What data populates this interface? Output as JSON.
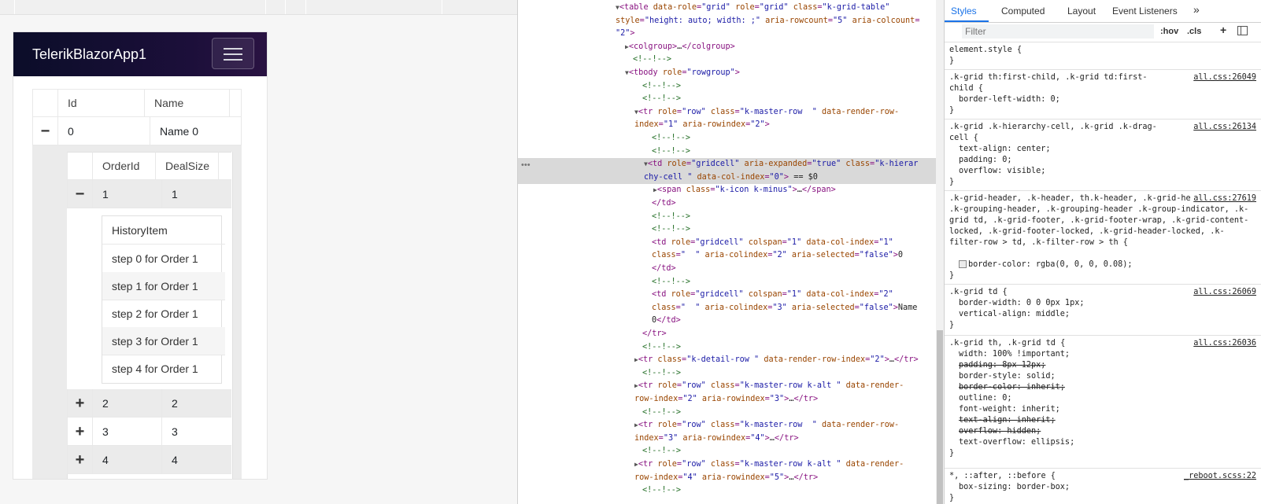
{
  "app": {
    "brand": "TelerikBlazorApp1",
    "grid": {
      "headers": [
        "Id",
        "Name"
      ],
      "row": {
        "icon": "−",
        "id": "0",
        "name": "Name 0"
      },
      "detail": {
        "headers": [
          "OrderId",
          "DealSize"
        ],
        "expanded_row": {
          "icon": "−",
          "order_id": "1",
          "deal_size": "1"
        },
        "history_header": "HistoryItem",
        "history_items": [
          "step 0 for Order 1",
          "step 1 for Order 1",
          "step 2 for Order 1",
          "step 3 for Order 1",
          "step 4 for Order 1"
        ],
        "collapsed_rows": [
          {
            "icon": "+",
            "order_id": "2",
            "deal_size": "2"
          },
          {
            "icon": "+",
            "order_id": "3",
            "deal_size": "3"
          },
          {
            "icon": "+",
            "order_id": "4",
            "deal_size": "4"
          }
        ]
      }
    }
  },
  "dom": {
    "selected_marker": "== $0",
    "more_button": "•••"
  },
  "styles": {
    "tabs": [
      "Styles",
      "Computed",
      "Layout",
      "Event Listeners",
      "»"
    ],
    "filter_placeholder": "Filter",
    "hov": ":hov",
    "cls": ".cls",
    "plus": "+",
    "rules": [
      {
        "selector": "element.style {",
        "source": ""
      },
      {
        "selector": ".k-grid th:first-child, .k-grid td:first-child {",
        "source": "all.css:26049",
        "props": [
          "border-left-width: 0;"
        ]
      },
      {
        "selector": ".k-grid .k-hierarchy-cell, .k-grid .k-drag-cell {",
        "source": "all.css:26134",
        "props": [
          "text-align: center;",
          "padding: 0;",
          "overflow: visible;"
        ]
      },
      {
        "selector": ".k-grid-header, .k-header, th.k-header, .k-grid-header-wrap, .k-grouping-header, .k-grouping-header .k-group-indicator, .k-grid td, .k-grid-footer, .k-grid-footer-wrap, .k-grid-content-locked, .k-grid-footer-locked, .k-grid-header-locked, .k-filter-row > td, .k-filter-row > th {",
        "source": "all.css:27619",
        "props": [
          "border-color: rgba(0, 0, 0, 0.08);"
        ]
      },
      {
        "selector": ".k-grid td {",
        "source": "all.css:26069",
        "props": [
          "border-width: 0 0 0px 1px;",
          "vertical-align: middle;"
        ]
      },
      {
        "selector": ".k-grid th, .k-grid td {",
        "source": "all.css:26036",
        "props": [
          "width: 100% !important;",
          "padding: 8px 12px;",
          "border-style: solid;",
          "border-color: inherit;",
          "outline: 0;",
          "font-weight: inherit;",
          "text-align: inherit;",
          "overflow: hidden;",
          "text-overflow: ellipsis;"
        ]
      },
      {
        "selector": "*, ::after, ::before {",
        "source": "_reboot.scss:22",
        "props": [
          "box-sizing: border-box;"
        ]
      }
    ]
  }
}
